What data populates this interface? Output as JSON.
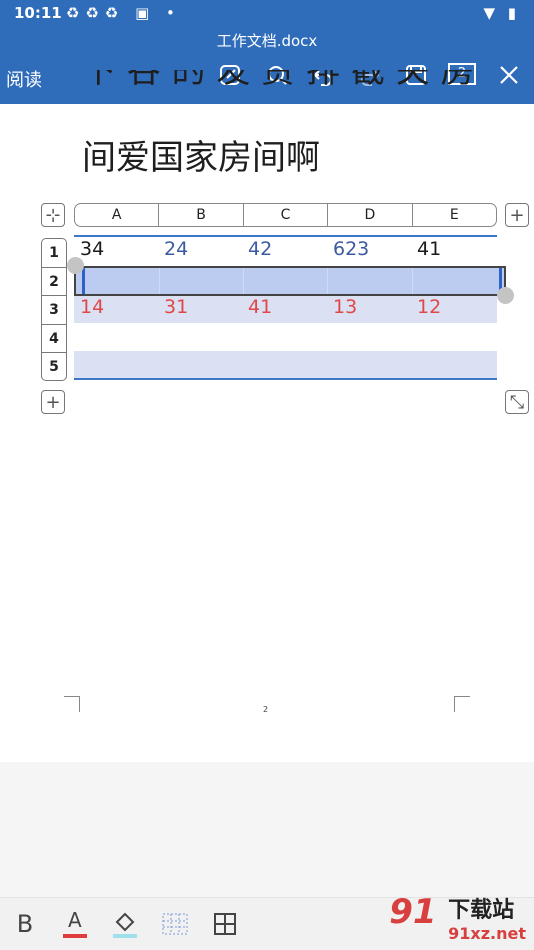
{
  "status": {
    "time": "10:11",
    "icons": "♻♻♻ ▣ •",
    "right": "▼ ▮"
  },
  "header": {
    "title": "工作文档.docx",
    "mode": "阅读",
    "page_count": "2"
  },
  "document": {
    "line1": "下 谷 的 发 贾 排 截 关 房",
    "line2": "间爱国家房间啊"
  },
  "table": {
    "columns": [
      "A",
      "B",
      "C",
      "D",
      "E"
    ],
    "rows": [
      "1",
      "2",
      "3",
      "4",
      "5"
    ],
    "row1": [
      "34",
      "24",
      "42",
      "623",
      "41"
    ],
    "row3": [
      "14",
      "31",
      "41",
      "13",
      "12"
    ]
  },
  "page_number": "2",
  "icons": {
    "move": "⊹",
    "add_col": "+",
    "add_row": "+",
    "resize": "⤡"
  },
  "toolbar": {
    "bold": "B",
    "font_color": "A"
  },
  "watermark": {
    "logo": "91",
    "brand": "下载站",
    "url": "91xz.net"
  },
  "colors": {
    "header_bg": "#2f6dbb",
    "selection": "#bcccf0",
    "band": "#dbe0f3",
    "red_text": "#e04848",
    "blue_text": "#3b5aa0"
  }
}
